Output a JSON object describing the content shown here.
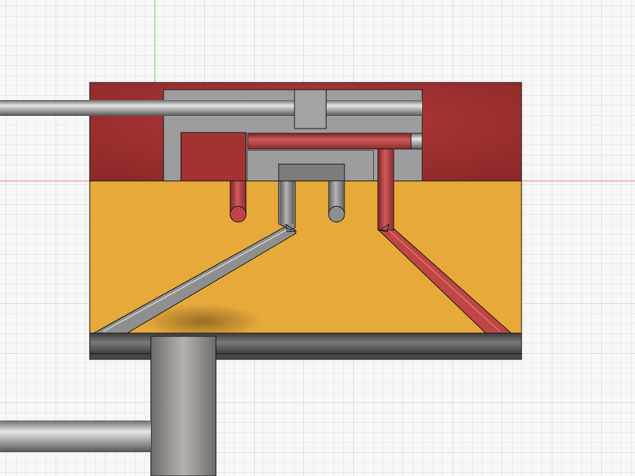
{
  "viewport": {
    "background_color": "#f7f7f7",
    "grid_minor_color": "#e2e2e2",
    "grid_major_color": "#cfcfcf",
    "axis_vertical_color": "#86d986",
    "axis_horizontal_color": "#e58a8a"
  },
  "model": {
    "upper_housing_color": "#a93434",
    "lower_body_color": "#e7a93a",
    "base_plate_color": "#555555",
    "steel_part_color": "#9b9b9b",
    "red_pin_color": "#b53d3d",
    "edge_color": "#1a1a1a"
  }
}
